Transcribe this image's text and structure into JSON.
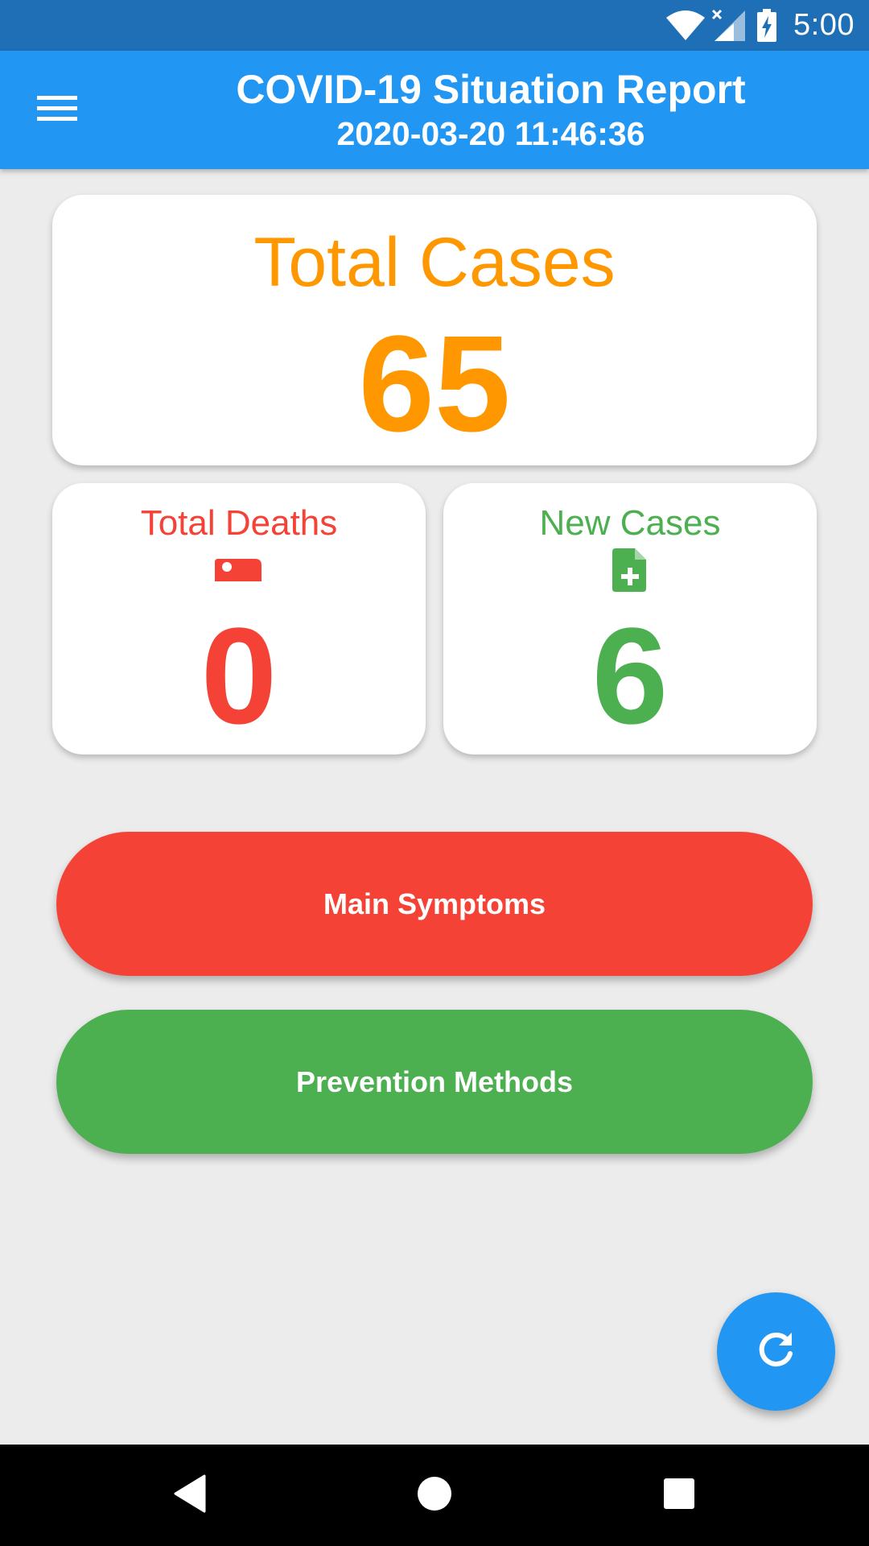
{
  "status_bar": {
    "time": "5:00",
    "icons": [
      "wifi-icon",
      "cell-signal-icon",
      "battery-charging-icon"
    ]
  },
  "app_bar": {
    "menu_icon": "menu-icon",
    "title": "COVID-19 Situation Report",
    "subtitle": "2020-03-20 11:46:36"
  },
  "stats": {
    "total": {
      "label": "Total Cases",
      "value": "65"
    },
    "deaths": {
      "label": "Total Deaths",
      "value": "0",
      "icon": "bed-icon"
    },
    "new_cases": {
      "label": "New Cases",
      "value": "6",
      "icon": "file-plus-icon"
    }
  },
  "buttons": {
    "symptoms": "Main Symptoms",
    "prevention": "Prevention Methods"
  },
  "fab": {
    "icon": "refresh-icon"
  },
  "nav": [
    "back-icon",
    "home-icon",
    "recents-icon"
  ],
  "colors": {
    "status_bar": "#1e6fb5",
    "app_bar": "#2196f3",
    "background": "#ececec",
    "total_accent": "#ff9800",
    "deaths_accent": "#f44336",
    "new_cases_accent": "#4caf50",
    "symptoms_button": "#f44336",
    "prevention_button": "#4caf50",
    "fab": "#2196f3"
  }
}
